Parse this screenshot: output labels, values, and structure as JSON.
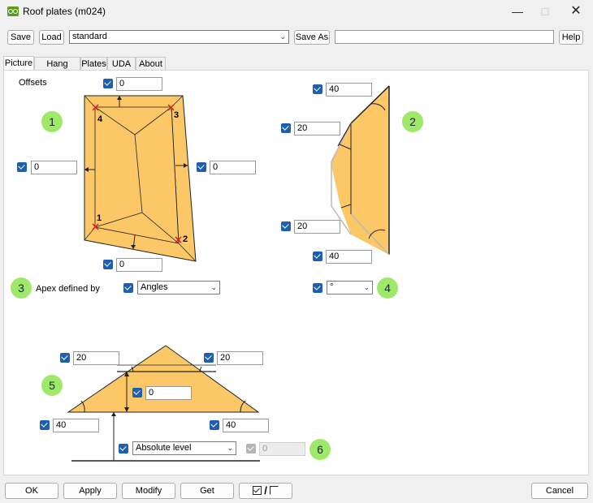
{
  "window": {
    "title": "Roof plates (m024)"
  },
  "toolbar": {
    "save_label": "Save",
    "load_label": "Load",
    "preset_value": "standard",
    "saveas_label": "Save As",
    "saveas_value": "",
    "help_label": "Help"
  },
  "tabs": [
    {
      "label": "Picture",
      "active": true
    },
    {
      "label": "Hang overs"
    },
    {
      "label": "Plates"
    },
    {
      "label": "UDA"
    },
    {
      "label": "About"
    }
  ],
  "picture": {
    "offsets_label": "Offsets",
    "badges": [
      "1",
      "2",
      "3",
      "4",
      "5",
      "6"
    ],
    "plan": {
      "top_value": "0",
      "left_value": "0",
      "right_value": "0",
      "bottom_value": "0",
      "corner_labels": [
        "1",
        "2",
        "3",
        "4"
      ]
    },
    "side": {
      "top_value": "40",
      "upper_value": "20",
      "lower_value": "20",
      "bottom_value": "40"
    },
    "apex_label": "Apex defined by",
    "apex_value": "Angles",
    "unit_value": "°",
    "section": {
      "left_upper_value": "20",
      "right_upper_value": "20",
      "height_value": "0",
      "left_lower_value": "40",
      "right_lower_value": "40",
      "level_value": "Absolute level",
      "level_offset_value": "0"
    }
  },
  "bottom_bar": {
    "ok_label": "OK",
    "apply_label": "Apply",
    "modify_label": "Modify",
    "get_label": "Get",
    "toggle_label": "/",
    "cancel_label": "Cancel"
  },
  "colors": {
    "plate_fill": "#fcc766",
    "badge": "#9ee86a",
    "checkbox": "#1e5fae"
  }
}
